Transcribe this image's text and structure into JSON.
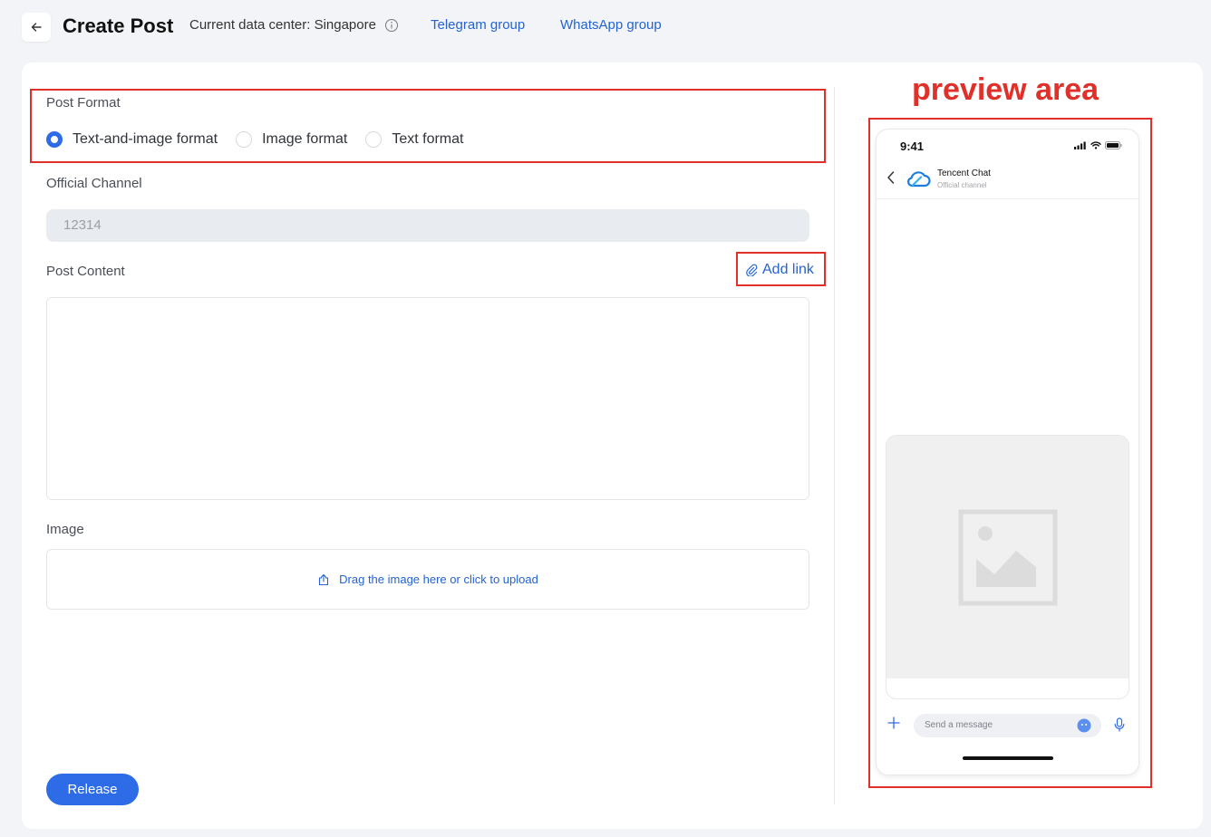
{
  "header": {
    "title": "Create Post",
    "data_center": "Current data center: Singapore",
    "links": [
      "Telegram group",
      "WhatsApp group"
    ]
  },
  "annotation": {
    "preview_label": "preview area"
  },
  "form": {
    "post_format_label": "Post Format",
    "formats": [
      "Text-and-image format",
      "Image format",
      "Text format"
    ],
    "selected_format": "Text-and-image format",
    "official_channel_label": "Official Channel",
    "official_channel_value": "12314",
    "post_content_label": "Post Content",
    "add_link_label": "Add link",
    "post_content_value": "",
    "image_label": "Image",
    "upload_text": "Drag the image here or click to upload",
    "release_label": "Release"
  },
  "preview": {
    "time": "9:41",
    "chat_name": "Tencent Chat",
    "chat_subtitle": "Official channel",
    "input_placeholder": "Send a message"
  },
  "colors": {
    "accent": "#2e6be6",
    "link": "#2463d1",
    "annotation": "#e0302a"
  },
  "icons": [
    "back-arrow-icon",
    "info-icon",
    "paperclip-icon",
    "upload-icon",
    "chevron-left-icon",
    "cloud-logo-icon",
    "image-placeholder-icon",
    "plus-icon",
    "emoji-icon",
    "microphone-icon",
    "signal-icon",
    "wifi-icon",
    "battery-icon"
  ]
}
